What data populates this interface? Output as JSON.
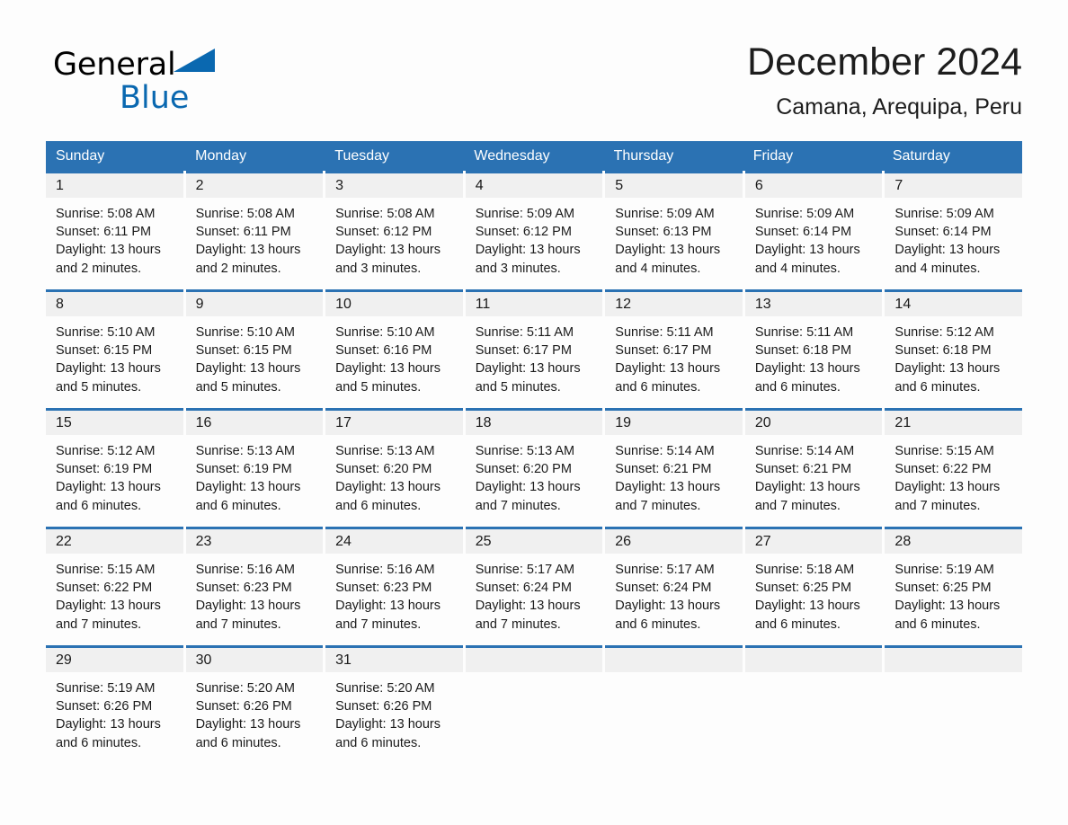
{
  "brand": {
    "name_part1": "General",
    "name_part2": "Blue",
    "triangle_color": "#0a68b0"
  },
  "header": {
    "title": "December 2024",
    "location": "Camana, Arequipa, Peru"
  },
  "theme": {
    "header_blue": "#2b72b3",
    "day_band_gray": "#f0f0f0",
    "page_background": "#fdfdfd",
    "text_color": "#1a1a1a"
  },
  "weekdays": [
    "Sunday",
    "Monday",
    "Tuesday",
    "Wednesday",
    "Thursday",
    "Friday",
    "Saturday"
  ],
  "weeks": [
    {
      "days": [
        {
          "date": "1",
          "sunrise": "Sunrise: 5:08 AM",
          "sunset": "Sunset: 6:11 PM",
          "daylight_line1": "Daylight: 13 hours",
          "daylight_line2": "and 2 minutes."
        },
        {
          "date": "2",
          "sunrise": "Sunrise: 5:08 AM",
          "sunset": "Sunset: 6:11 PM",
          "daylight_line1": "Daylight: 13 hours",
          "daylight_line2": "and 2 minutes."
        },
        {
          "date": "3",
          "sunrise": "Sunrise: 5:08 AM",
          "sunset": "Sunset: 6:12 PM",
          "daylight_line1": "Daylight: 13 hours",
          "daylight_line2": "and 3 minutes."
        },
        {
          "date": "4",
          "sunrise": "Sunrise: 5:09 AM",
          "sunset": "Sunset: 6:12 PM",
          "daylight_line1": "Daylight: 13 hours",
          "daylight_line2": "and 3 minutes."
        },
        {
          "date": "5",
          "sunrise": "Sunrise: 5:09 AM",
          "sunset": "Sunset: 6:13 PM",
          "daylight_line1": "Daylight: 13 hours",
          "daylight_line2": "and 4 minutes."
        },
        {
          "date": "6",
          "sunrise": "Sunrise: 5:09 AM",
          "sunset": "Sunset: 6:14 PM",
          "daylight_line1": "Daylight: 13 hours",
          "daylight_line2": "and 4 minutes."
        },
        {
          "date": "7",
          "sunrise": "Sunrise: 5:09 AM",
          "sunset": "Sunset: 6:14 PM",
          "daylight_line1": "Daylight: 13 hours",
          "daylight_line2": "and 4 minutes."
        }
      ]
    },
    {
      "days": [
        {
          "date": "8",
          "sunrise": "Sunrise: 5:10 AM",
          "sunset": "Sunset: 6:15 PM",
          "daylight_line1": "Daylight: 13 hours",
          "daylight_line2": "and 5 minutes."
        },
        {
          "date": "9",
          "sunrise": "Sunrise: 5:10 AM",
          "sunset": "Sunset: 6:15 PM",
          "daylight_line1": "Daylight: 13 hours",
          "daylight_line2": "and 5 minutes."
        },
        {
          "date": "10",
          "sunrise": "Sunrise: 5:10 AM",
          "sunset": "Sunset: 6:16 PM",
          "daylight_line1": "Daylight: 13 hours",
          "daylight_line2": "and 5 minutes."
        },
        {
          "date": "11",
          "sunrise": "Sunrise: 5:11 AM",
          "sunset": "Sunset: 6:17 PM",
          "daylight_line1": "Daylight: 13 hours",
          "daylight_line2": "and 5 minutes."
        },
        {
          "date": "12",
          "sunrise": "Sunrise: 5:11 AM",
          "sunset": "Sunset: 6:17 PM",
          "daylight_line1": "Daylight: 13 hours",
          "daylight_line2": "and 6 minutes."
        },
        {
          "date": "13",
          "sunrise": "Sunrise: 5:11 AM",
          "sunset": "Sunset: 6:18 PM",
          "daylight_line1": "Daylight: 13 hours",
          "daylight_line2": "and 6 minutes."
        },
        {
          "date": "14",
          "sunrise": "Sunrise: 5:12 AM",
          "sunset": "Sunset: 6:18 PM",
          "daylight_line1": "Daylight: 13 hours",
          "daylight_line2": "and 6 minutes."
        }
      ]
    },
    {
      "days": [
        {
          "date": "15",
          "sunrise": "Sunrise: 5:12 AM",
          "sunset": "Sunset: 6:19 PM",
          "daylight_line1": "Daylight: 13 hours",
          "daylight_line2": "and 6 minutes."
        },
        {
          "date": "16",
          "sunrise": "Sunrise: 5:13 AM",
          "sunset": "Sunset: 6:19 PM",
          "daylight_line1": "Daylight: 13 hours",
          "daylight_line2": "and 6 minutes."
        },
        {
          "date": "17",
          "sunrise": "Sunrise: 5:13 AM",
          "sunset": "Sunset: 6:20 PM",
          "daylight_line1": "Daylight: 13 hours",
          "daylight_line2": "and 6 minutes."
        },
        {
          "date": "18",
          "sunrise": "Sunrise: 5:13 AM",
          "sunset": "Sunset: 6:20 PM",
          "daylight_line1": "Daylight: 13 hours",
          "daylight_line2": "and 7 minutes."
        },
        {
          "date": "19",
          "sunrise": "Sunrise: 5:14 AM",
          "sunset": "Sunset: 6:21 PM",
          "daylight_line1": "Daylight: 13 hours",
          "daylight_line2": "and 7 minutes."
        },
        {
          "date": "20",
          "sunrise": "Sunrise: 5:14 AM",
          "sunset": "Sunset: 6:21 PM",
          "daylight_line1": "Daylight: 13 hours",
          "daylight_line2": "and 7 minutes."
        },
        {
          "date": "21",
          "sunrise": "Sunrise: 5:15 AM",
          "sunset": "Sunset: 6:22 PM",
          "daylight_line1": "Daylight: 13 hours",
          "daylight_line2": "and 7 minutes."
        }
      ]
    },
    {
      "days": [
        {
          "date": "22",
          "sunrise": "Sunrise: 5:15 AM",
          "sunset": "Sunset: 6:22 PM",
          "daylight_line1": "Daylight: 13 hours",
          "daylight_line2": "and 7 minutes."
        },
        {
          "date": "23",
          "sunrise": "Sunrise: 5:16 AM",
          "sunset": "Sunset: 6:23 PM",
          "daylight_line1": "Daylight: 13 hours",
          "daylight_line2": "and 7 minutes."
        },
        {
          "date": "24",
          "sunrise": "Sunrise: 5:16 AM",
          "sunset": "Sunset: 6:23 PM",
          "daylight_line1": "Daylight: 13 hours",
          "daylight_line2": "and 7 minutes."
        },
        {
          "date": "25",
          "sunrise": "Sunrise: 5:17 AM",
          "sunset": "Sunset: 6:24 PM",
          "daylight_line1": "Daylight: 13 hours",
          "daylight_line2": "and 7 minutes."
        },
        {
          "date": "26",
          "sunrise": "Sunrise: 5:17 AM",
          "sunset": "Sunset: 6:24 PM",
          "daylight_line1": "Daylight: 13 hours",
          "daylight_line2": "and 6 minutes."
        },
        {
          "date": "27",
          "sunrise": "Sunrise: 5:18 AM",
          "sunset": "Sunset: 6:25 PM",
          "daylight_line1": "Daylight: 13 hours",
          "daylight_line2": "and 6 minutes."
        },
        {
          "date": "28",
          "sunrise": "Sunrise: 5:19 AM",
          "sunset": "Sunset: 6:25 PM",
          "daylight_line1": "Daylight: 13 hours",
          "daylight_line2": "and 6 minutes."
        }
      ]
    },
    {
      "days": [
        {
          "date": "29",
          "sunrise": "Sunrise: 5:19 AM",
          "sunset": "Sunset: 6:26 PM",
          "daylight_line1": "Daylight: 13 hours",
          "daylight_line2": "and 6 minutes."
        },
        {
          "date": "30",
          "sunrise": "Sunrise: 5:20 AM",
          "sunset": "Sunset: 6:26 PM",
          "daylight_line1": "Daylight: 13 hours",
          "daylight_line2": "and 6 minutes."
        },
        {
          "date": "31",
          "sunrise": "Sunrise: 5:20 AM",
          "sunset": "Sunset: 6:26 PM",
          "daylight_line1": "Daylight: 13 hours",
          "daylight_line2": "and 6 minutes."
        },
        {
          "date": "",
          "sunrise": "",
          "sunset": "",
          "daylight_line1": "",
          "daylight_line2": ""
        },
        {
          "date": "",
          "sunrise": "",
          "sunset": "",
          "daylight_line1": "",
          "daylight_line2": ""
        },
        {
          "date": "",
          "sunrise": "",
          "sunset": "",
          "daylight_line1": "",
          "daylight_line2": ""
        },
        {
          "date": "",
          "sunrise": "",
          "sunset": "",
          "daylight_line1": "",
          "daylight_line2": ""
        }
      ]
    }
  ]
}
